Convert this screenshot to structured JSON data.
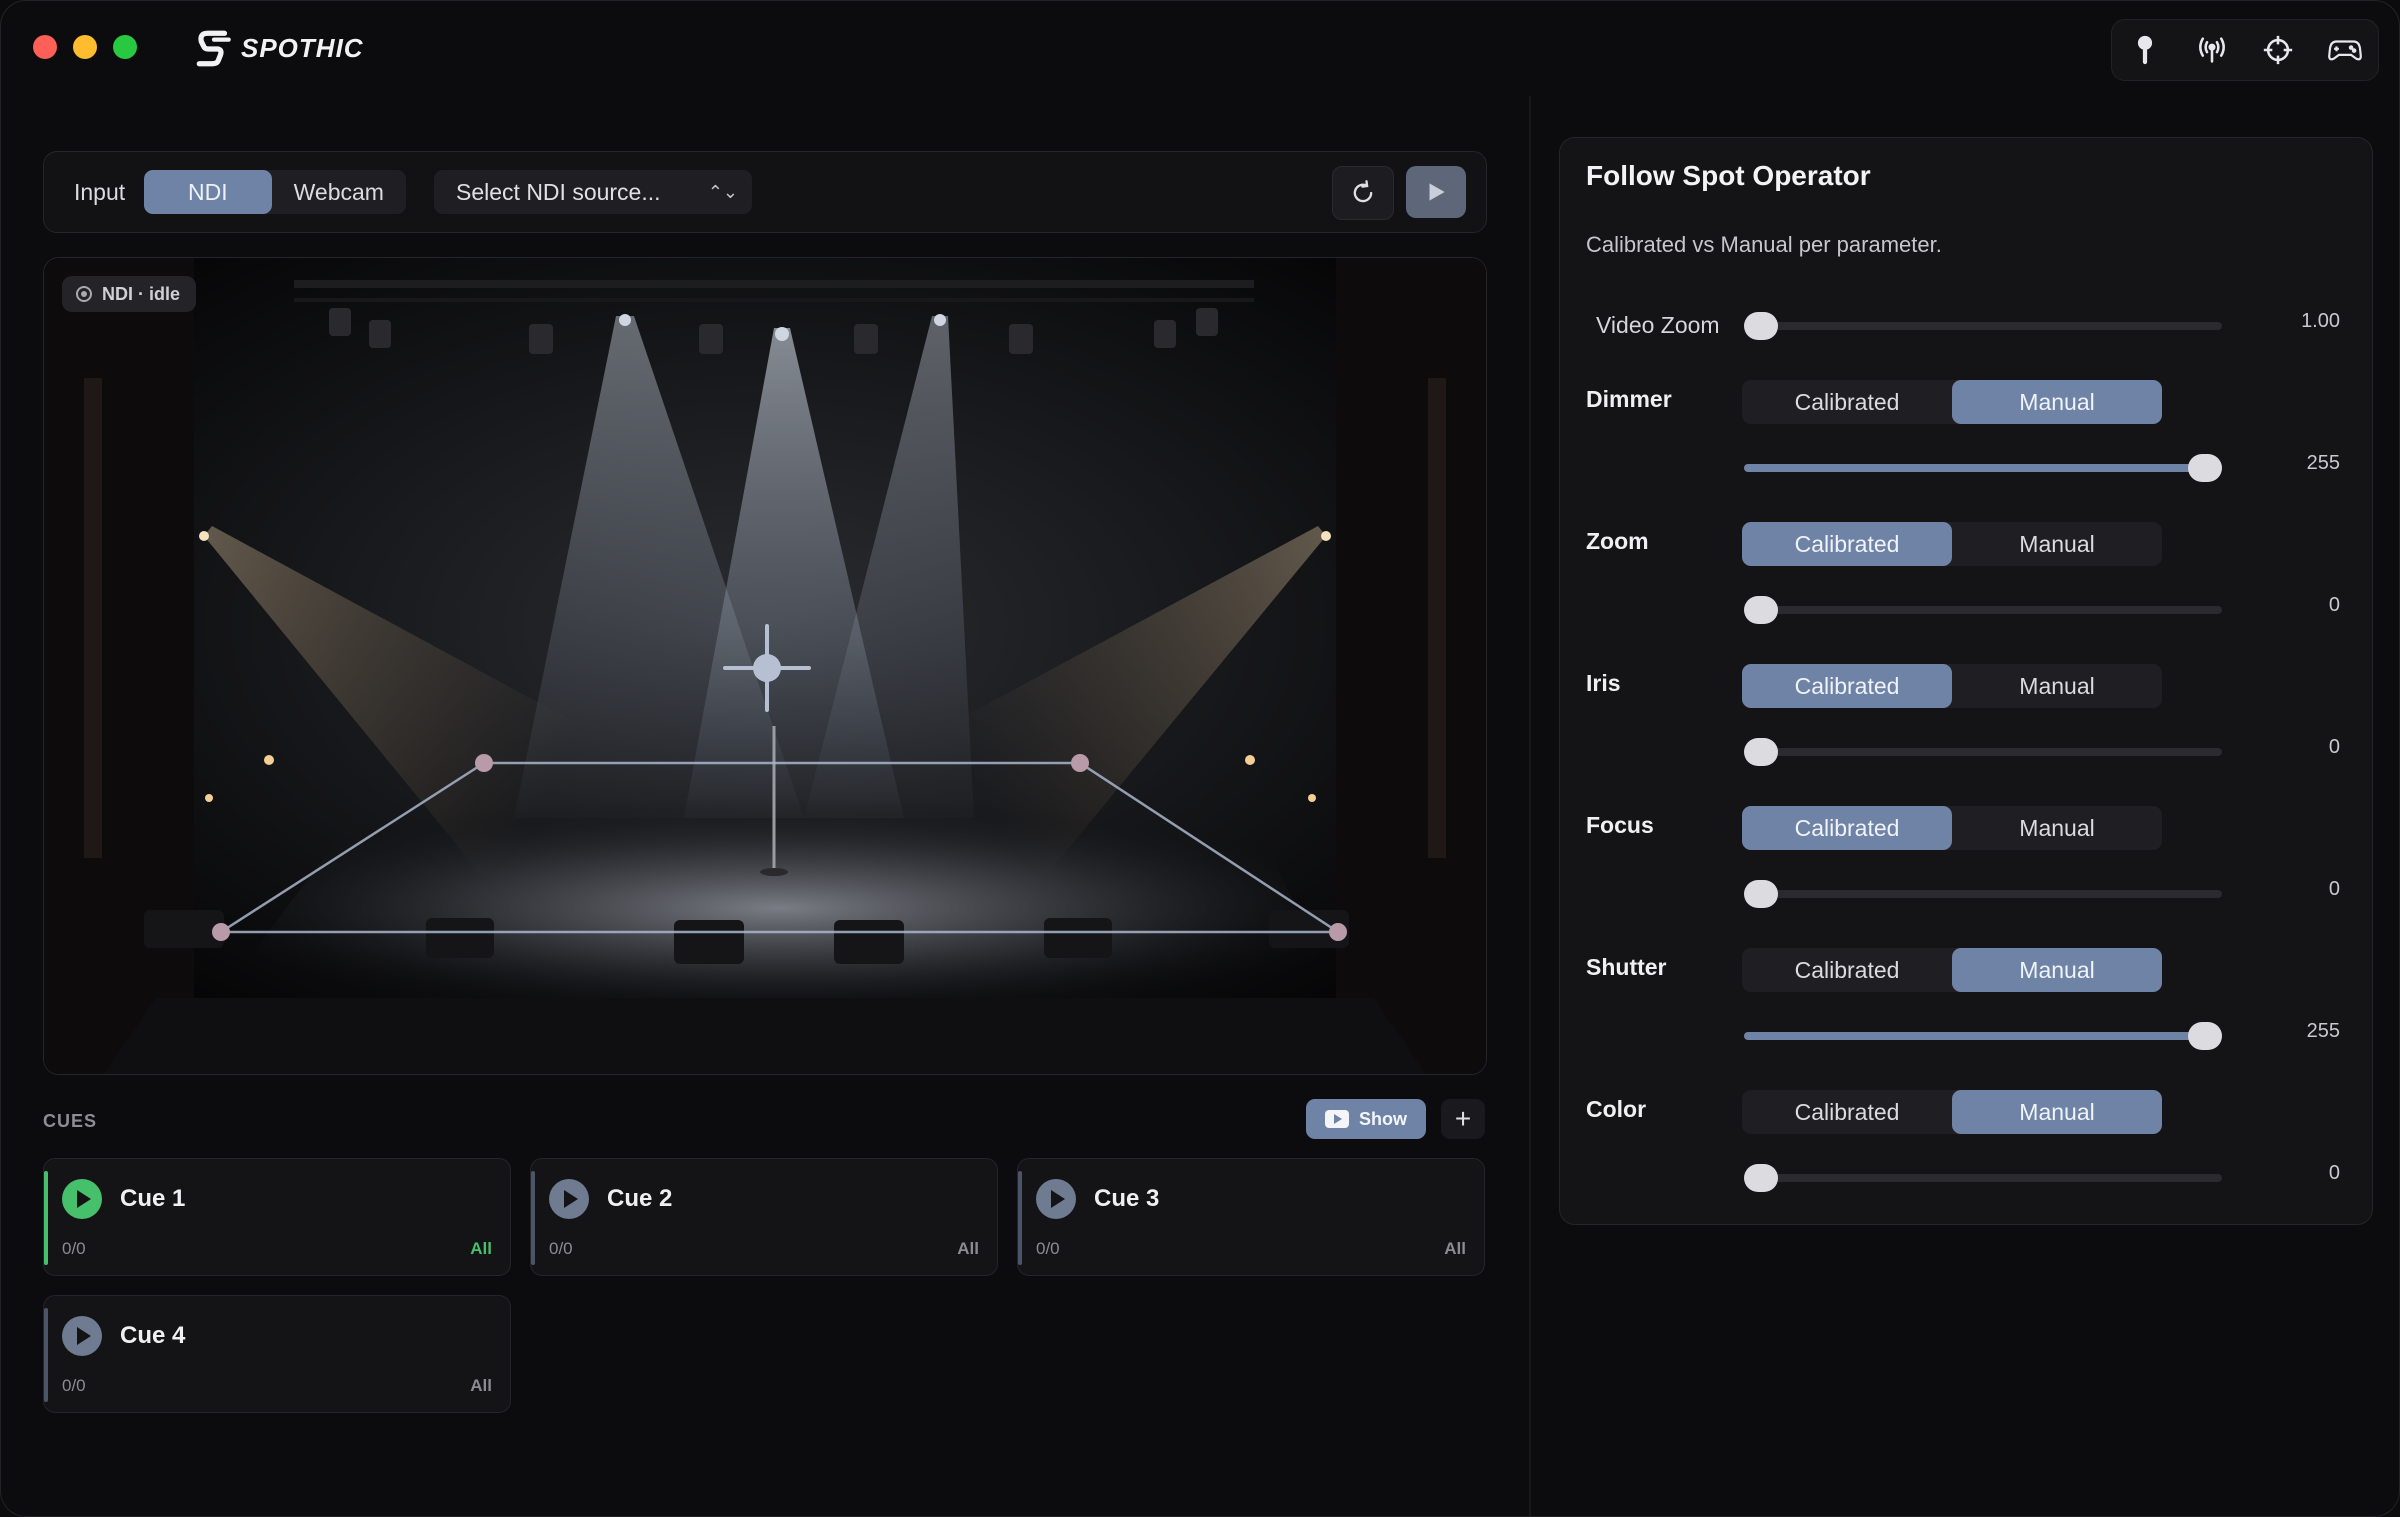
{
  "app": {
    "name": "SPOTHIC"
  },
  "top_icons": [
    "pin-icon",
    "broadcast-icon",
    "crosshair-icon",
    "gamepad-icon"
  ],
  "input_bar": {
    "label": "Input",
    "options": [
      "NDI",
      "Webcam"
    ],
    "selected": "NDI",
    "source_placeholder": "Select NDI source..."
  },
  "video": {
    "status": "NDI · idle"
  },
  "cues": {
    "label": "CUES",
    "show_label": "Show",
    "add_label": "+",
    "items": [
      {
        "name": "Cue 1",
        "count": "0/0",
        "scope": "All",
        "active": true
      },
      {
        "name": "Cue 2",
        "count": "0/0",
        "scope": "All",
        "active": false
      },
      {
        "name": "Cue 3",
        "count": "0/0",
        "scope": "All",
        "active": false
      },
      {
        "name": "Cue 4",
        "count": "0/0",
        "scope": "All",
        "active": false
      }
    ]
  },
  "panel": {
    "title": "Follow Spot Operator",
    "subtitle": "Calibrated vs Manual per parameter.",
    "video_zoom": {
      "label": "Video Zoom",
      "value": "1.00",
      "fraction": 0.0
    },
    "mode_labels": {
      "calibrated": "Calibrated",
      "manual": "Manual"
    },
    "params": [
      {
        "name": "Dimmer",
        "mode": "Manual",
        "value": "255",
        "fraction": 1.0
      },
      {
        "name": "Zoom",
        "mode": "Calibrated",
        "value": "0",
        "fraction": 0.0
      },
      {
        "name": "Iris",
        "mode": "Calibrated",
        "value": "0",
        "fraction": 0.0
      },
      {
        "name": "Focus",
        "mode": "Calibrated",
        "value": "0",
        "fraction": 0.0
      },
      {
        "name": "Shutter",
        "mode": "Manual",
        "value": "255",
        "fraction": 1.0
      },
      {
        "name": "Color",
        "mode": "Manual",
        "value": "0",
        "fraction": 0.0
      }
    ]
  },
  "colors": {
    "accent": "#6f83a6",
    "active_green": "#46c06a",
    "background": "#0c0c0e"
  }
}
